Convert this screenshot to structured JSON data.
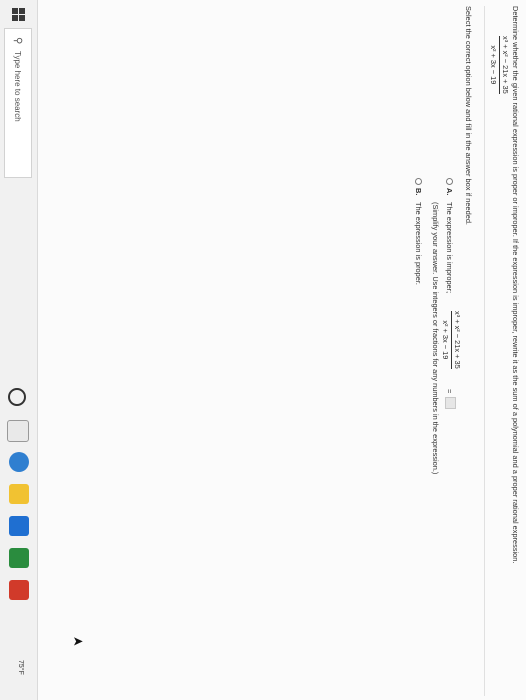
{
  "question": {
    "prompt": "Determine whether the given rational expression is proper or improper. If the expression is improper, rewrite it as the sum of a polynomial and a proper rational expression.",
    "expression": {
      "numerator": "x³ + x² − 21x + 35",
      "denominator": "x² + 3x − 19"
    },
    "instruction": "Select the correct option below and fill in the answer box if needed."
  },
  "options": {
    "a": {
      "letter": "A.",
      "text_before": "The expression is improper;",
      "expression": {
        "numerator": "x³ + x² − 21x + 35",
        "denominator": "x² + 3x − 19"
      },
      "equals": "=",
      "answer_value": "",
      "hint": "(Simplify your answer. Use integers or fractions for any numbers in the expression.)",
      "selected": false
    },
    "b": {
      "letter": "B.",
      "text": "The expression is proper.",
      "selected": false
    }
  },
  "taskbar": {
    "search_placeholder": "Type here to search",
    "apps": [
      "cortana-icon",
      "task-view-icon",
      "edge-icon",
      "file-explorer-icon",
      "store-icon",
      "mail-icon",
      "office-icon"
    ],
    "weather": "75°F"
  },
  "colors": {
    "page_bg": "#fbfbfb",
    "taskbar_bg": "#f1f1f1",
    "text": "#303030",
    "answer_box": "#e6e6e6"
  }
}
